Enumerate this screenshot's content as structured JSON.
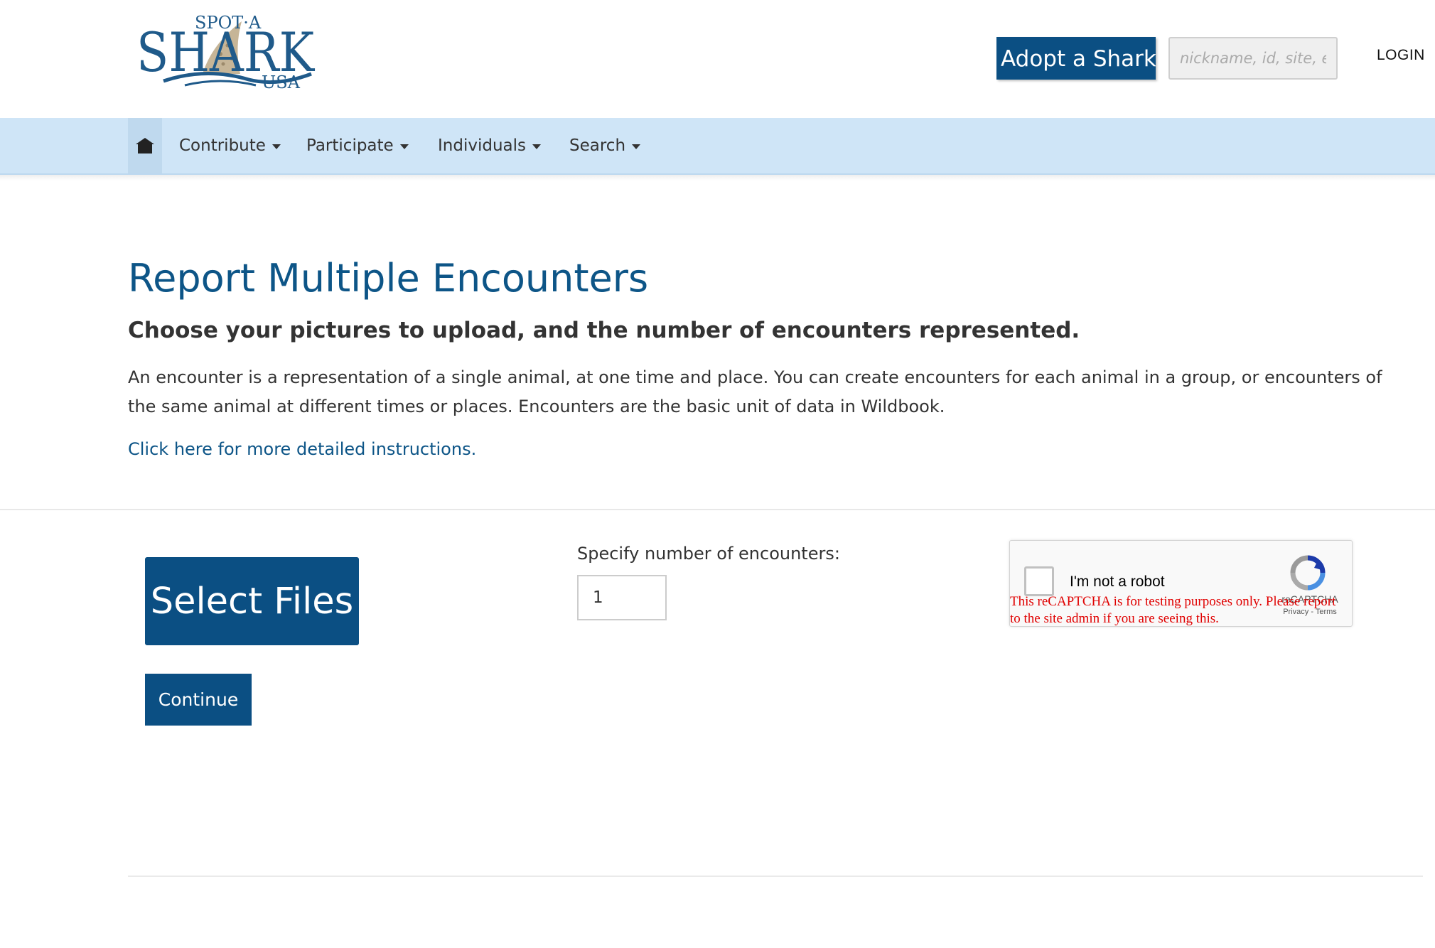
{
  "header": {
    "logo": {
      "top_text": "SPOT·A",
      "main_text": "SHARK",
      "bottom_text": "USA"
    },
    "adopt_label": "Adopt a Shark",
    "search_placeholder": "nickname, id, site, encounter nu",
    "login_label": "LOGIN"
  },
  "nav": {
    "items": [
      {
        "label": "Contribute"
      },
      {
        "label": "Participate"
      },
      {
        "label": "Individuals"
      },
      {
        "label": "Search"
      }
    ]
  },
  "intro": {
    "title": "Report Multiple Encounters",
    "subtitle": "Choose your pictures to upload, and the number of encounters represented.",
    "description": "An encounter is a representation of a single animal, at one time and place. You can create encounters for each animal in a group, or encounters of the same animal at different times or places. Encounters are the basic unit of data in Wildbook.",
    "instructions_link": "Click here for more detailed instructions."
  },
  "form": {
    "select_files_label": "Select Files",
    "count_label": "Specify number of encounters:",
    "count_value": "1",
    "continue_label": "Continue"
  },
  "recaptcha": {
    "label": "I'm not a robot",
    "brand": "reCAPTCHA",
    "terms": "Privacy - Terms",
    "warning": "This reCAPTCHA is for testing purposes only. Please report to the site admin if you are seeing this."
  },
  "colors": {
    "brand_blue": "#0b4f83",
    "title_blue": "#0d5587",
    "nav_background": "#cfe5f7",
    "warning_red": "#e00000"
  }
}
